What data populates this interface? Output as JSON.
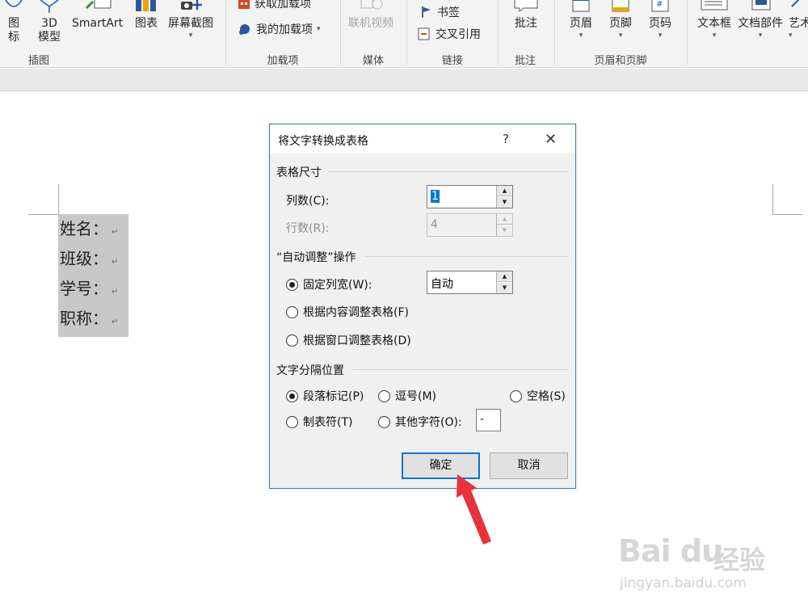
{
  "ribbon": {
    "groups": {
      "illustrations": "插图",
      "addins": "加载项",
      "media": "媒体",
      "links": "链接",
      "comments": "批注",
      "header_footer": "页眉和页脚"
    },
    "buttons": {
      "icons_l1": "图",
      "icons_l2": "标",
      "model3d_l1": "3D",
      "model3d_l2": "模型",
      "smartart": "SmartArt",
      "chart": "图表",
      "screenshot": "屏幕截图",
      "get_addins": "获取加载项",
      "my_addins": "我的加载项",
      "online_video": "联机视频",
      "bookmark": "书签",
      "cross_reference": "交叉引用",
      "comment": "批注",
      "header": "页眉",
      "footer": "页脚",
      "page_number": "页码",
      "text_box": "文本框",
      "quick_parts": "文档部件",
      "wordart": "艺术"
    }
  },
  "document": {
    "lines": [
      "姓名：",
      "班级：",
      "学号：",
      "职称："
    ]
  },
  "dialog": {
    "title": "将文字转换成表格",
    "help": "?",
    "close": "✕",
    "table_size": {
      "heading": "表格尺寸",
      "columns_label": "列数(C):",
      "columns_value": "1",
      "rows_label": "行数(R):",
      "rows_value": "4"
    },
    "autofit": {
      "heading": "“自动调整”操作",
      "fixed_label": "固定列宽(W):",
      "fixed_value": "自动",
      "fit_contents": "根据内容调整表格(F)",
      "fit_window": "根据窗口调整表格(D)",
      "selected": "fixed"
    },
    "separator": {
      "heading": "文字分隔位置",
      "paragraph": "段落标记(P)",
      "comma": "逗号(M)",
      "space": "空格(S)",
      "tab": "制表符(T)",
      "other": "其他字符(O):",
      "other_value": "-",
      "selected": "paragraph"
    },
    "ok": "确定",
    "cancel": "取消"
  },
  "watermark": {
    "brand": "Bai du",
    "brand_cn": "经验",
    "url": "jingyan.baidu.com"
  },
  "colors": {
    "accent": "#0078d7",
    "arrow": "#e8323c",
    "selection": "#c8c8c8"
  }
}
